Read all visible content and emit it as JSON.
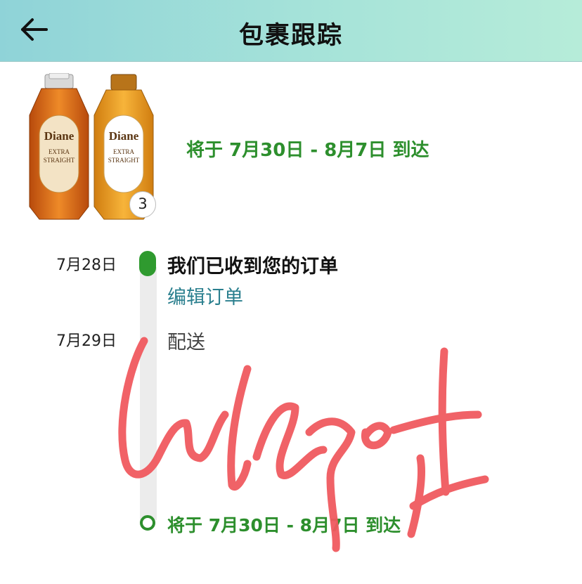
{
  "header": {
    "title": "包裹跟踪",
    "back_icon": "arrow-left-icon"
  },
  "product": {
    "items": [
      {
        "brand": "Diane",
        "line1": "EXTRA",
        "line2": "STRAIGHT",
        "color": "#e07a1f"
      },
      {
        "brand": "Diane",
        "line1": "EXTRA",
        "line2": "STRAIGHT",
        "color": "#f0a52a"
      }
    ],
    "quantity": "3",
    "eta": "将于 7月30日 - 8月7日 到达"
  },
  "timeline": {
    "events": [
      {
        "date": "7月28日",
        "title": "我们已收到您的订单",
        "link": "编辑订单"
      },
      {
        "date": "7月29日",
        "title": "配送"
      }
    ],
    "final_eta": "将于 7月30日 - 8月7日 到达"
  },
  "annotation": {
    "color": "#f05a5f"
  },
  "colors": {
    "accent_green": "#2d8f2d",
    "link_teal": "#2a7f8e"
  }
}
